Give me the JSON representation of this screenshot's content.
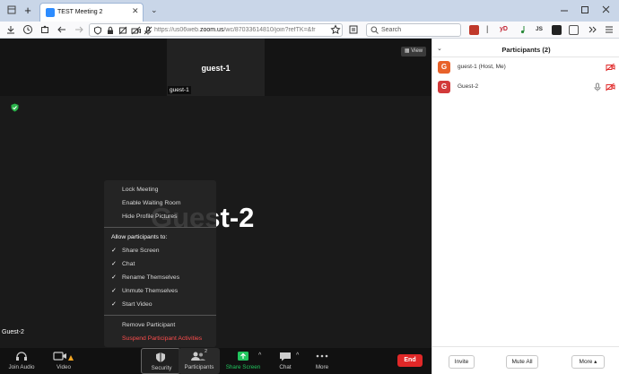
{
  "browser": {
    "tab_title": "TEST Meeting 2",
    "tab_close": "✕",
    "new_tab": "+",
    "tab_list": "⌄",
    "url_prefix": "https://us06web.",
    "url_domain": "zoom.us",
    "url_path": "/wc/87033614810/join?refTK=&fr",
    "search_placeholder": "Search",
    "ext_yd": "yD",
    "ext_js": "JS"
  },
  "meeting": {
    "gallery_tile_name": "guest-1",
    "gallery_tile_label": "guest-1",
    "view_button": "View",
    "main_speaker": "Guest-2",
    "main_label": "Guest-2"
  },
  "security_menu": {
    "items_top": [
      "Lock Meeting",
      "Enable Waiting Room",
      "Hide Profile Pictures"
    ],
    "allow_header": "Allow participants to:",
    "allow_items": [
      "Share Screen",
      "Chat",
      "Rename Themselves",
      "Unmute Themselves",
      "Start Video"
    ],
    "check": "✓",
    "remove": "Remove Participant",
    "suspend": "Suspend Participant Activities"
  },
  "toolbar": {
    "join_audio": "Join Audio",
    "video": "Video",
    "security": "Security",
    "participants": "Participants",
    "participants_count": "2",
    "share_screen": "Share Screen",
    "chat": "Chat",
    "more": "More",
    "end": "End"
  },
  "participants_panel": {
    "title": "Participants (2)",
    "participants": [
      {
        "initial": "G",
        "name": "guest-1 (Host, Me)",
        "color": "#e8622a"
      },
      {
        "initial": "G",
        "name": "Guest-2",
        "color": "#d23a3a"
      }
    ],
    "invite": "Invite",
    "mute_all": "Mute All",
    "more": "More ▴"
  },
  "colors": {
    "accent": "#2d8cff",
    "end_red": "#e02828",
    "share_green": "#22c55e",
    "suspend_red": "#ff4d4d"
  }
}
